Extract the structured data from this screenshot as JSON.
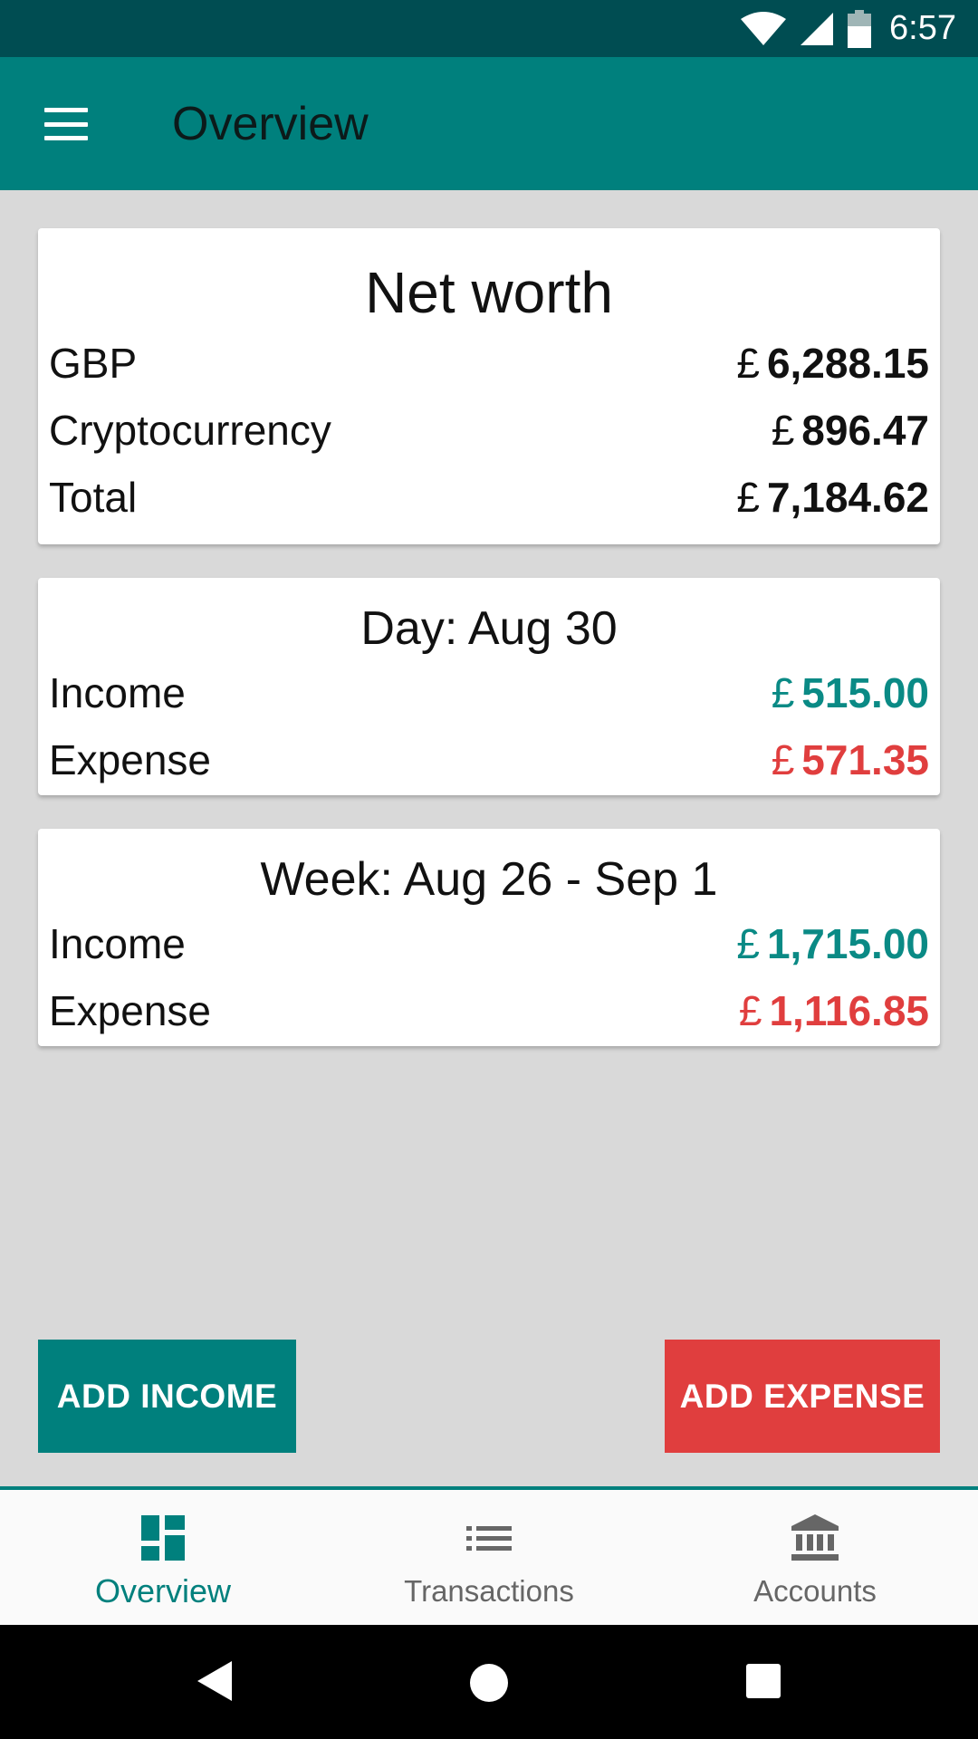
{
  "status_bar": {
    "time": "6:57"
  },
  "app_bar": {
    "title": "Overview",
    "menu_icon": "hamburger-menu-icon"
  },
  "net_worth": {
    "title": "Net worth",
    "rows": [
      {
        "label": "GBP",
        "currency": "£",
        "value": "6,288.15"
      },
      {
        "label": "Cryptocurrency",
        "currency": "£",
        "value": "896.47"
      },
      {
        "label": "Total",
        "currency": "£",
        "value": "7,184.62"
      }
    ]
  },
  "day": {
    "title": "Day: Aug 30",
    "income": {
      "label": "Income",
      "currency": "£",
      "value": "515.00"
    },
    "expense": {
      "label": "Expense",
      "currency": "£",
      "value": "571.35"
    }
  },
  "week": {
    "title": "Week: Aug 26 - Sep 1",
    "income": {
      "label": "Income",
      "currency": "£",
      "value": "1,715.00"
    },
    "expense": {
      "label": "Expense",
      "currency": "£",
      "value": "1,116.85"
    }
  },
  "actions": {
    "add_income": "ADD INCOME",
    "add_expense": "ADD EXPENSE"
  },
  "bottom_nav": [
    {
      "label": "Overview",
      "icon": "dashboard-icon",
      "active": true
    },
    {
      "label": "Transactions",
      "icon": "list-icon",
      "active": false
    },
    {
      "label": "Accounts",
      "icon": "bank-icon",
      "active": false
    }
  ],
  "colors": {
    "primary": "#00807d",
    "status_bar": "#004d52",
    "income": "#0a8a85",
    "expense": "#e03e3e"
  }
}
